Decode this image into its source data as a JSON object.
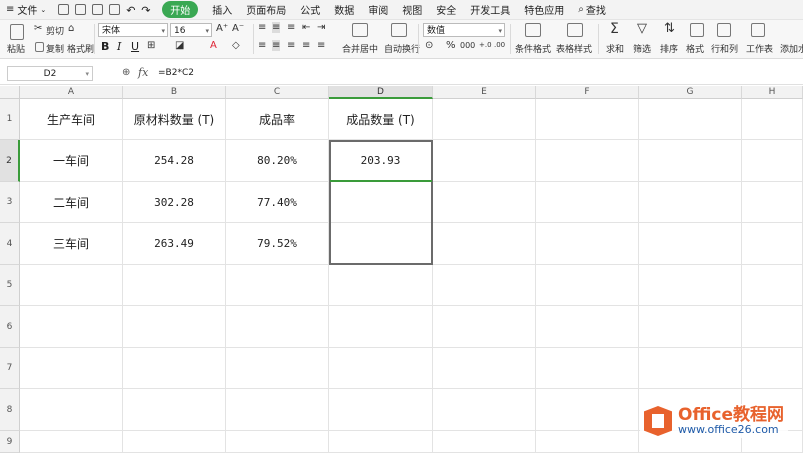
{
  "menubar": {
    "file_label": "文件",
    "items": [
      "开始",
      "插入",
      "页面布局",
      "公式",
      "数据",
      "审阅",
      "视图",
      "安全",
      "开发工具",
      "特色应用"
    ],
    "active_index": 0,
    "search_label": "查找"
  },
  "ribbon": {
    "paste": "粘贴",
    "cut": "剪切",
    "copy": "复制",
    "format_painter": "格式刷",
    "font_name": "宋体",
    "font_size": "16",
    "bold": "B",
    "italic": "I",
    "underline": "U",
    "merge_center": "合并居中",
    "wrap_text": "自动换行",
    "number_format": "数值",
    "conditional_format": "条件格式",
    "table_style": "表格样式",
    "sum": "求和",
    "filter": "筛选",
    "sort": "排序",
    "format": "格式",
    "rows_cols": "行和列",
    "worksheet": "工作表",
    "add_watermark": "添加水印"
  },
  "formula_bar": {
    "cell_ref": "D2",
    "fx_label": "fx",
    "formula": "=B2*C2"
  },
  "sheet": {
    "columns": [
      "A",
      "B",
      "C",
      "D",
      "E",
      "F",
      "G",
      "H"
    ],
    "rows": [
      "1",
      "2",
      "3",
      "4",
      "5",
      "6",
      "7",
      "8",
      "9"
    ],
    "header": [
      "生产车间",
      "原材料数量 (T)",
      "成品率",
      "成品数量 (T)"
    ],
    "data": [
      [
        "一车间",
        "254.28",
        "80.20%",
        "203.93"
      ],
      [
        "二车间",
        "302.28",
        "77.40%",
        ""
      ],
      [
        "三车间",
        "263.49",
        "79.52%",
        ""
      ]
    ],
    "active_cell": "D2",
    "selection": "D2:D4"
  },
  "watermark": {
    "line1": "Office教程网",
    "line2": "www.office26.com"
  },
  "colors": {
    "accent_green": "#3aa853",
    "selection_border": "#6b6b6b",
    "watermark_orange": "#e8622d",
    "watermark_blue": "#1e5aa8"
  }
}
